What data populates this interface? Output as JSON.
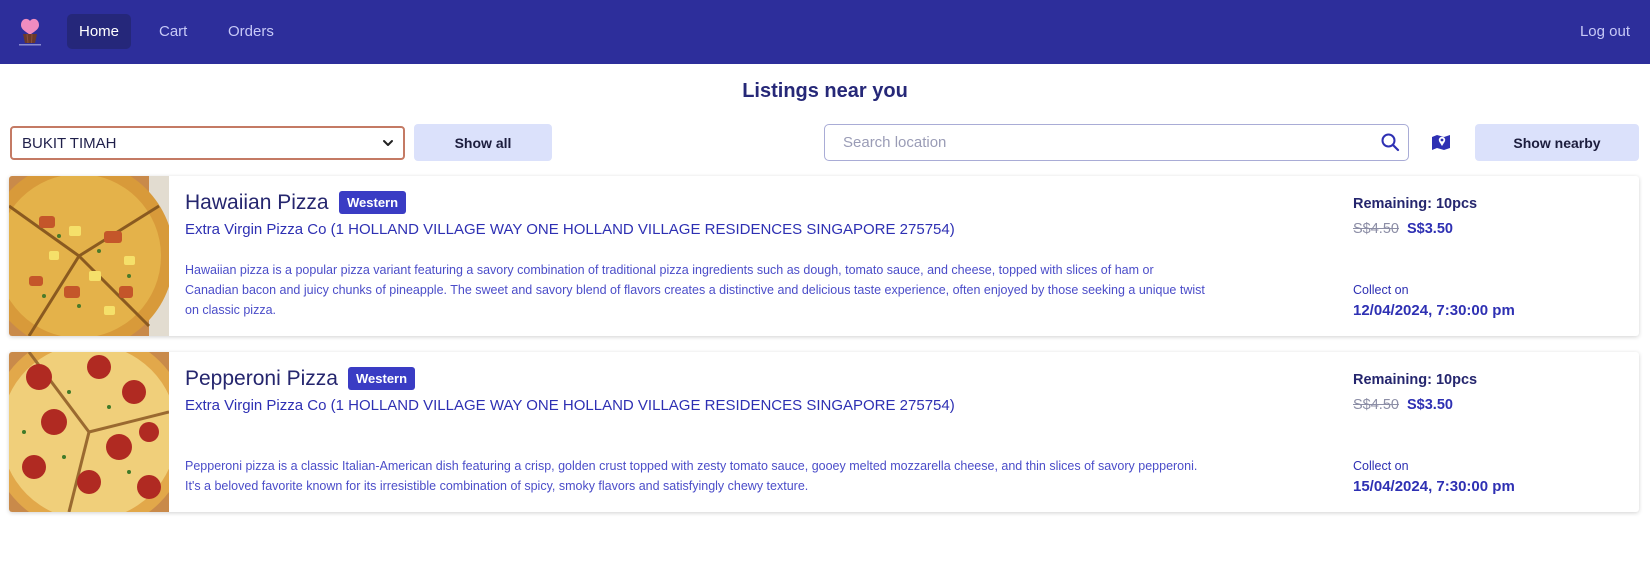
{
  "nav": {
    "home": "Home",
    "cart": "Cart",
    "orders": "Orders",
    "logout": "Log out",
    "logo_icon": "cupcake-logo-icon"
  },
  "page": {
    "title": "Listings near you"
  },
  "filters": {
    "region_selected": "BUKIT TIMAH",
    "show_all": "Show all",
    "search_placeholder": "Search location",
    "search_value": "",
    "show_nearby": "Show nearby",
    "map_icon": "map-icon",
    "search_icon": "search-icon"
  },
  "listings": [
    {
      "title": "Hawaiian Pizza",
      "tag": "Western",
      "store": "Extra Virgin Pizza Co (1 HOLLAND VILLAGE WAY ONE HOLLAND VILLAGE RESIDENCES SINGAPORE 275754)",
      "description": "Hawaiian pizza is a popular pizza variant featuring a savory combination of traditional pizza ingredients such as dough, tomato sauce, and cheese, topped with slices of ham or Canadian bacon and juicy chunks of pineapple. The sweet and savory blend of flavors creates a distinctive and delicious taste experience, often enjoyed by those seeking a unique twist on classic pizza.",
      "remaining": "Remaining: 10pcs",
      "old_price": "S$4.50",
      "new_price": "S$3.50",
      "collect_label": "Collect on",
      "collect_date": "12/04/2024, 7:30:00 pm"
    },
    {
      "title": "Pepperoni Pizza",
      "tag": "Western",
      "store": "Extra Virgin Pizza Co (1 HOLLAND VILLAGE WAY ONE HOLLAND VILLAGE RESIDENCES SINGAPORE 275754)",
      "description": "Pepperoni pizza is a classic Italian-American dish featuring a crisp, golden crust topped with zesty tomato sauce, gooey melted mozzarella cheese, and thin slices of savory pepperoni. It's a beloved favorite known for its irresistible combination of spicy, smoky flavors and satisfyingly chewy texture.",
      "remaining": "Remaining: 10pcs",
      "old_price": "S$4.50",
      "new_price": "S$3.50",
      "collect_label": "Collect on",
      "collect_date": "15/04/2024, 7:30:00 pm"
    }
  ]
}
